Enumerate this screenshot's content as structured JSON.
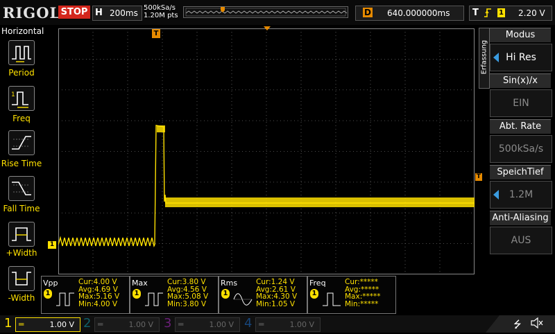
{
  "brand": "RIGOL",
  "run_state": "STOP",
  "horizontal": {
    "key": "H",
    "timebase": "200ms"
  },
  "sampling": {
    "rate": "500kSa/s",
    "points": "1.20M pts"
  },
  "delay": {
    "key": "D",
    "value": "640.000000ms"
  },
  "trigger": {
    "key": "T",
    "edge_icon": "rising-edge-icon",
    "source": "1",
    "level": "2.20 V"
  },
  "left_panel": {
    "title": "Horizontal",
    "items": [
      {
        "label": "Period",
        "icon": "period-icon"
      },
      {
        "label": "Freq",
        "icon": "freq-icon"
      },
      {
        "label": "Rise Time",
        "icon": "rise-time-icon"
      },
      {
        "label": "Fall Time",
        "icon": "fall-time-icon"
      },
      {
        "label": "+Width",
        "icon": "pos-width-icon"
      },
      {
        "label": "-Width",
        "icon": "neg-width-icon"
      }
    ]
  },
  "right_panel": {
    "menu_title": "Erfassung",
    "items": [
      {
        "title": "Modus",
        "value": "Hi Res",
        "active": true
      },
      {
        "title": "Sin(x)/x",
        "value": "EIN",
        "active": false
      },
      {
        "title": "Abt. Rate",
        "value": "500kSa/s",
        "active": false
      },
      {
        "title": "SpeichTief",
        "value": "1.2M",
        "active": true
      },
      {
        "title": "Anti-Aliasing",
        "value": "AUS",
        "active": false
      }
    ]
  },
  "grid_markers": {
    "channel_ground": "1",
    "trigger_marker": "T"
  },
  "measurements": [
    {
      "name": "Vpp",
      "channel": "1",
      "cur": "Cur:4.00 V",
      "avg": "Avg:4.69 V",
      "max": "Max:5.16 V",
      "min": "Min:4.00 V"
    },
    {
      "name": "Max",
      "channel": "1",
      "cur": "Cur:3.80 V",
      "avg": "Avg:4.56 V",
      "max": "Max:5.08 V",
      "min": "Min:3.80 V"
    },
    {
      "name": "Rms",
      "channel": "1",
      "cur": "Cur:1.24 V",
      "avg": "Avg:2.61 V",
      "max": "Max:4.30 V",
      "min": "Min:1.05 V"
    },
    {
      "name": "Freq",
      "channel": "1",
      "cur": "Cur:*****",
      "avg": "Avg:*****",
      "max": "Max:*****",
      "min": "Min:*****"
    }
  ],
  "channels": [
    {
      "num": "1",
      "scale": "1.00 V",
      "color": "#ffe100"
    },
    {
      "num": "2",
      "scale": "1.00 V",
      "color": "#00bcd4"
    },
    {
      "num": "3",
      "scale": "1.00 V",
      "color": "#e040fb"
    },
    {
      "num": "4",
      "scale": "1.00 V",
      "color": "#1e88e5"
    }
  ],
  "status_icons": [
    "usb-icon",
    "speaker-muted-icon"
  ],
  "colors": {
    "trace": "#ffe100",
    "accent_orange": "#e68a00",
    "stop_red": "#d4261c",
    "grid": "#6a6a6a"
  }
}
